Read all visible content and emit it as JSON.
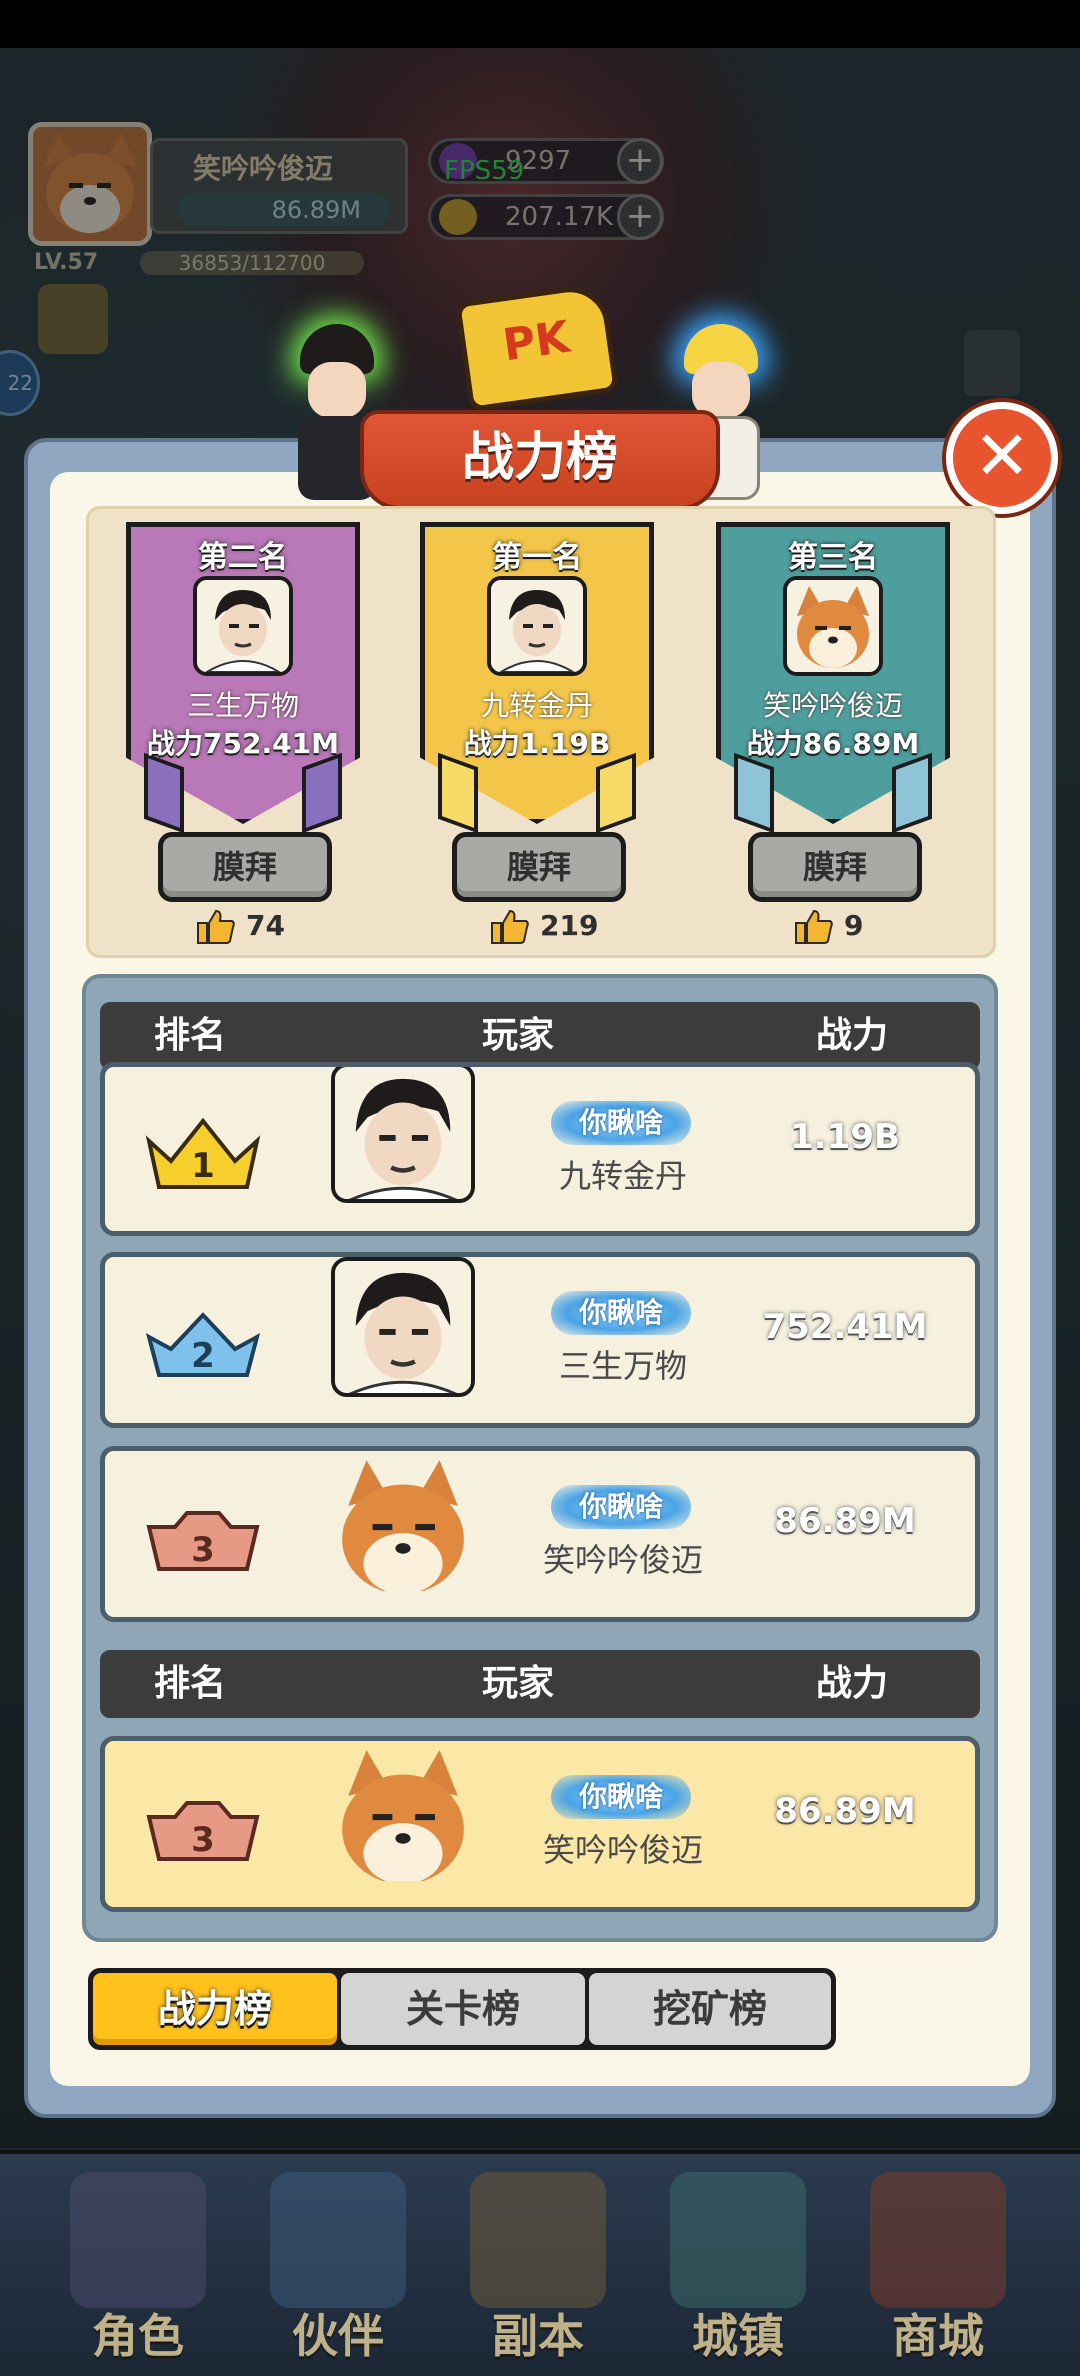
{
  "hud": {
    "player_name": "笑吟吟俊迈",
    "player_power": "86.89M",
    "level": "LV.57",
    "xp": "36853/112700",
    "gems": "9297",
    "gold": "207.17K",
    "fps": "FPS59",
    "side_badge": "22"
  },
  "pk_flag": "PK",
  "panel": {
    "title": "战力榜"
  },
  "podium": [
    {
      "place": "第二名",
      "name": "三生万物",
      "power": "战力752.41M",
      "worship": "膜拜",
      "likes": "74",
      "color": "#b978b7",
      "tail": "#8a6fbf"
    },
    {
      "place": "第一名",
      "name": "九转金丹",
      "power": "战力1.19B",
      "worship": "膜拜",
      "likes": "219",
      "color": "#f3c64a",
      "tail": "#f6db66"
    },
    {
      "place": "第三名",
      "name": "笑吟吟俊迈",
      "power": "战力86.89M",
      "worship": "膜拜",
      "likes": "9",
      "color": "#4f9e9e",
      "tail": "#8fc3d8"
    }
  ],
  "table": {
    "headers": {
      "rank": "排名",
      "player": "玩家",
      "power": "战力"
    },
    "rows": [
      {
        "rank": "1",
        "title": "你瞅啥",
        "name": "九转金丹",
        "power": "1.19B"
      },
      {
        "rank": "2",
        "title": "你瞅啥",
        "name": "三生万物",
        "power": "752.41M"
      },
      {
        "rank": "3",
        "title": "你瞅啥",
        "name": "笑吟吟俊迈",
        "power": "86.89M"
      }
    ],
    "my_row": {
      "rank": "3",
      "title": "你瞅啥",
      "name": "笑吟吟俊迈",
      "power": "86.89M"
    }
  },
  "tabs": [
    {
      "label": "战力榜",
      "active": true
    },
    {
      "label": "关卡榜",
      "active": false
    },
    {
      "label": "挖矿榜",
      "active": false
    }
  ],
  "nav": [
    {
      "label": "角色",
      "icon": "character-icon"
    },
    {
      "label": "伙伴",
      "icon": "partner-icon"
    },
    {
      "label": "副本",
      "icon": "dungeon-icon"
    },
    {
      "label": "城镇",
      "icon": "town-icon"
    },
    {
      "label": "商城",
      "icon": "shop-icon"
    }
  ],
  "colors": {
    "accent_yellow": "#ffc11c",
    "close_red": "#e8542e",
    "panel_blue": "#8fa7c0"
  }
}
